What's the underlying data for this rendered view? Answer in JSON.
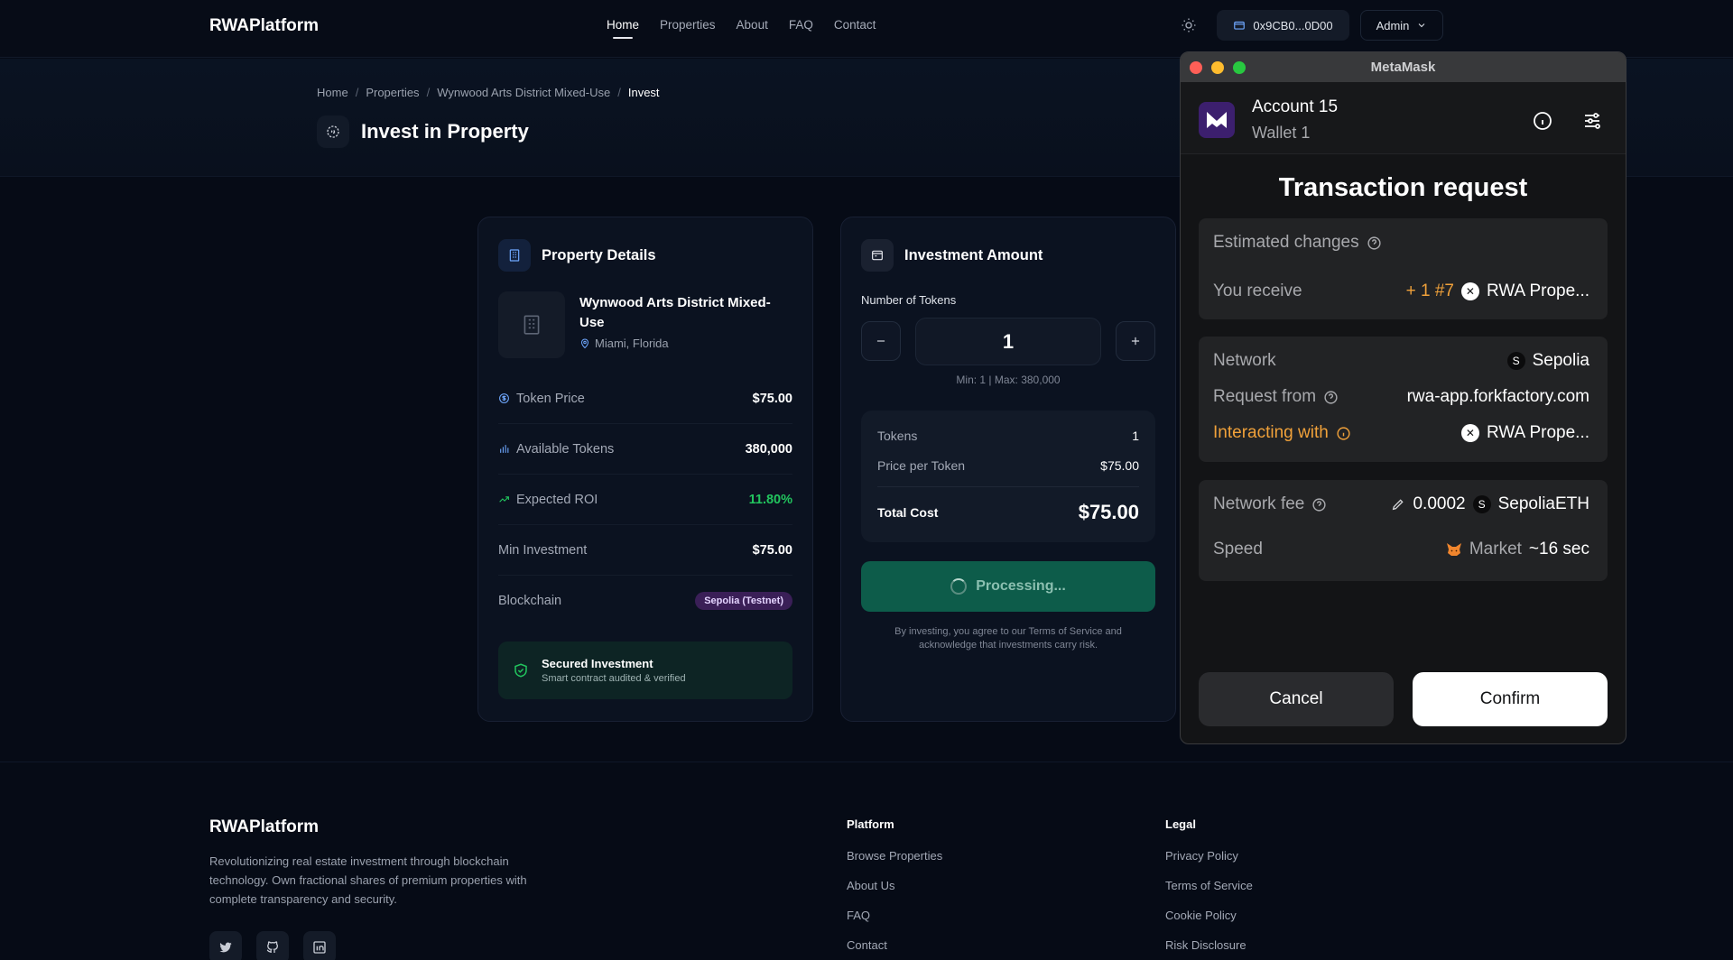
{
  "nav": {
    "brand": "RWAPlatform",
    "links": [
      "Home",
      "Properties",
      "About",
      "FAQ",
      "Contact"
    ],
    "wallet": "0x9CB0...0D00",
    "admin": "Admin"
  },
  "hero": {
    "breadcrumb": [
      "Home",
      "Properties",
      "Wynwood Arts District Mixed-Use",
      "Invest"
    ],
    "title": "Invest in Property"
  },
  "property": {
    "header": "Property Details",
    "name": "Wynwood Arts District Mixed-Use",
    "location": "Miami, Florida",
    "rows": [
      {
        "label": "Token Price",
        "value": "$75.00"
      },
      {
        "label": "Available Tokens",
        "value": "380,000"
      },
      {
        "label": "Expected ROI",
        "value": "11.80%"
      },
      {
        "label": "Min Investment",
        "value": "$75.00"
      },
      {
        "label": "Blockchain",
        "value": "Sepolia (Testnet)"
      }
    ],
    "secured_title": "Secured Investment",
    "secured_sub": "Smart contract audited & verified"
  },
  "investment": {
    "header": "Investment Amount",
    "tokens_label": "Number of Tokens",
    "quantity": "1",
    "minmax": "Min: 1 | Max: 380,000",
    "summary": {
      "tokens_label": "Tokens",
      "tokens_value": "1",
      "price_label": "Price per Token",
      "price_value": "$75.00",
      "total_label": "Total Cost",
      "total_value": "$75.00"
    },
    "button": "Processing...",
    "terms": "By investing, you agree to our Terms of Service and acknowledge that investments carry risk."
  },
  "footer": {
    "brand": "RWAPlatform",
    "description": "Revolutionizing real estate investment through blockchain technology. Own fractional shares of premium properties with complete transparency and security.",
    "platform_title": "Platform",
    "platform_links": [
      "Browse Properties",
      "About Us",
      "FAQ",
      "Contact"
    ],
    "legal_title": "Legal",
    "legal_links": [
      "Privacy Policy",
      "Terms of Service",
      "Cookie Policy",
      "Risk Disclosure"
    ]
  },
  "metamask": {
    "window_title": "MetaMask",
    "account": "Account 15",
    "wallet": "Wallet 1",
    "title": "Transaction request",
    "estimated_label": "Estimated changes",
    "receive_label": "You receive",
    "receive_amount": "+ 1 #7",
    "receive_asset": "RWA Prope...",
    "network_label": "Network",
    "network_icon": "S",
    "network_value": "Sepolia",
    "request_label": "Request from",
    "request_value": "rwa-app.forkfactory.com",
    "interacting_label": "Interacting with",
    "interacting_value": "RWA Prope...",
    "fee_label": "Network fee",
    "fee_value": "0.0002",
    "fee_currency": "SepoliaETH",
    "speed_label": "Speed",
    "speed_value": "Market",
    "speed_time": "~16 sec",
    "cancel": "Cancel",
    "confirm": "Confirm"
  },
  "colors": {
    "accent_green": "#22c55e",
    "warning_orange": "#f0a13a",
    "processing_bg": "#0d5c4a"
  }
}
